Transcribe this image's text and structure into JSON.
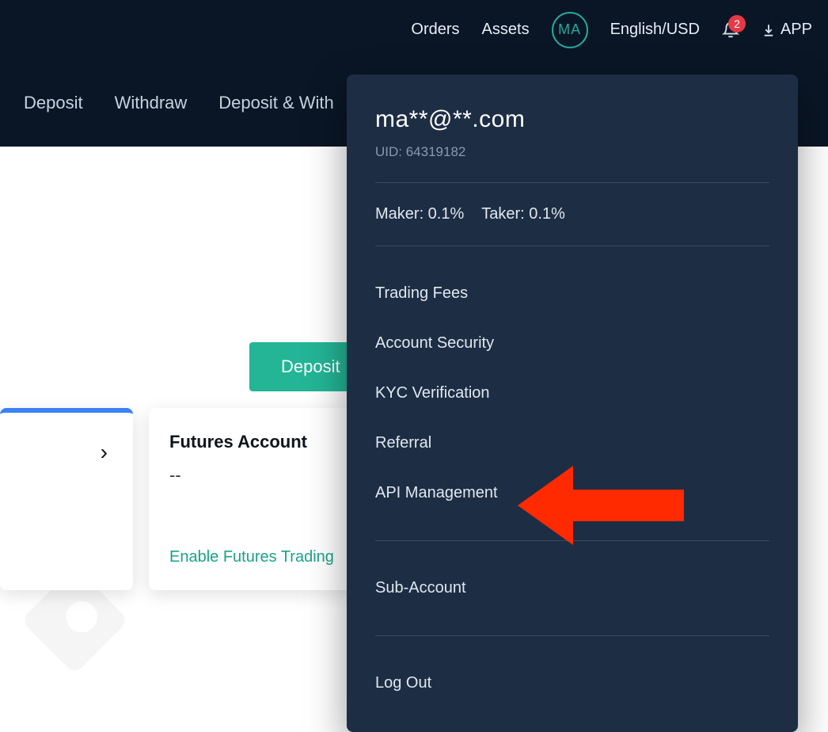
{
  "topbar": {
    "orders": "Orders",
    "assets": "Assets",
    "avatar_initials": "MA",
    "locale": "English/USD",
    "notification_count": "2",
    "app_label": "APP"
  },
  "subnav": {
    "deposit": "Deposit",
    "withdraw": "Withdraw",
    "history": "Deposit & With"
  },
  "main": {
    "deposit_button": "Deposit",
    "futures_card": {
      "title": "Futures Account",
      "value": "--",
      "action": "Enable Futures Trading"
    }
  },
  "dropdown": {
    "email": "ma**@**.com",
    "uid_label": "UID: 64319182",
    "maker": "Maker: 0.1%",
    "taker": "Taker: 0.1%",
    "items": {
      "trading_fees": "Trading Fees",
      "account_security": "Account Security",
      "kyc": "KYC Verification",
      "referral": "Referral",
      "api": "API Management",
      "subaccount": "Sub-Account",
      "logout": "Log Out"
    }
  }
}
